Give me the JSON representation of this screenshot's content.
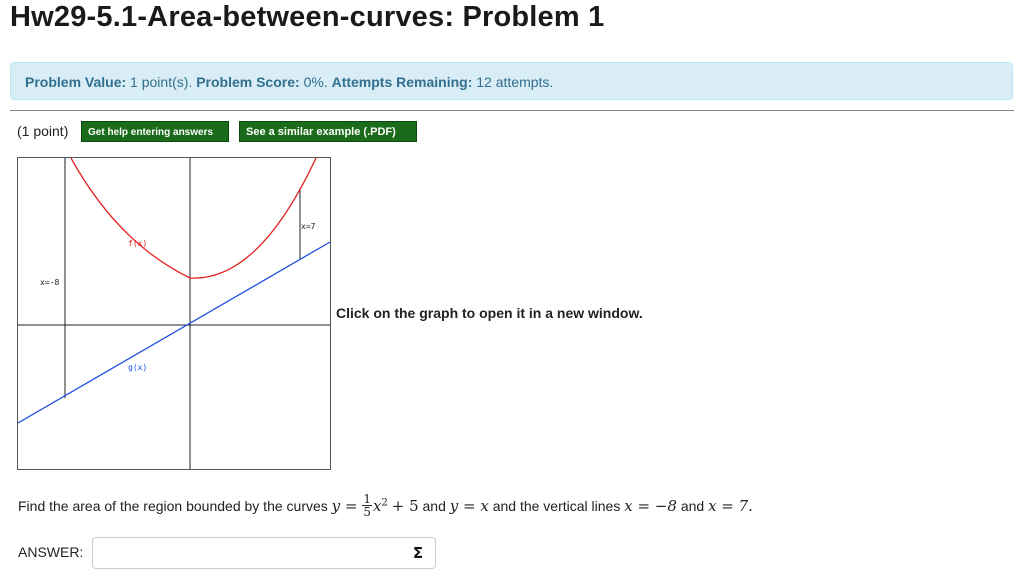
{
  "page": {
    "title": "Hw29-5.1-Area-between-curves: Problem 1"
  },
  "status": {
    "value_label": "Problem Value:",
    "value_text": "1 point(s).",
    "score_label": "Problem Score:",
    "score_text": "0%.",
    "attempts_label": "Attempts Remaining:",
    "attempts_text": "12 attempts."
  },
  "problem": {
    "points": "(1 point)",
    "help_button": "Get help entering answers",
    "example_button": "See a similar example (.PDF)",
    "click_graph": "Click on the graph to open it in a new window.",
    "graph_labels": {
      "f": "f(x)",
      "g": "g(x)",
      "left_line": "x=-8",
      "right_line": "x=7"
    },
    "question": {
      "prefix": "Find the area of the region bounded by the curves",
      "y_eq": "y =",
      "frac_num": "1",
      "frac_den": "5",
      "x_sq": "x",
      "sq": "2",
      "plus5": "+ 5",
      "and1": "and",
      "y_eq_x": "y = x",
      "and2": "and the vertical lines",
      "x_eq_m8": "x = −8",
      "and3": "and",
      "x_eq_7": "x = 7."
    },
    "answer_label": "ANSWER:",
    "answer_value": "",
    "sigma": "Σ"
  },
  "colors": {
    "f_curve": "#e02020",
    "g_line": "#2050e0",
    "button_bg": "#1a6b1a",
    "info_bg": "#d9edf7",
    "info_text": "#31708f"
  }
}
